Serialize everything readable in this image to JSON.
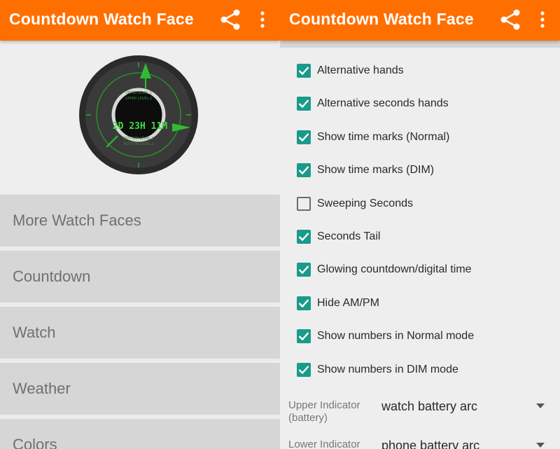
{
  "app_title": "Countdown Watch Face",
  "icons": {
    "share": "share-icon",
    "more": "more-vert-icon"
  },
  "colors": {
    "appbar": "#ff6f00",
    "accent": "#1a9a8a",
    "watch_green": "#3ddc3d"
  },
  "watch": {
    "upper_level_1": "UPPER LEVEL 1",
    "upper_level_2": "UPPER LEVEL 2",
    "countdown": "2D 23H 11M",
    "bottom_level_1": "BOTTOM LEVEL 1",
    "bottom_level_2": "BOTTOM LEVEL 2"
  },
  "menu": [
    {
      "label": "More Watch Faces"
    },
    {
      "label": "Countdown"
    },
    {
      "label": "Watch"
    },
    {
      "label": "Weather"
    },
    {
      "label": "Colors"
    }
  ],
  "settings": [
    {
      "label": "Alternative hands",
      "checked": true
    },
    {
      "label": "Alternative seconds hands",
      "checked": true
    },
    {
      "label": "Show time marks (Normal)",
      "checked": true
    },
    {
      "label": "Show time marks (DIM)",
      "checked": true
    },
    {
      "label": "Sweeping Seconds",
      "checked": false
    },
    {
      "label": "Seconds Tail",
      "checked": true
    },
    {
      "label": "Glowing countdown/digital time",
      "checked": true
    },
    {
      "label": "Hide AM/PM",
      "checked": true
    },
    {
      "label": "Show numbers in Normal mode",
      "checked": true
    },
    {
      "label": "Show numbers in DIM mode",
      "checked": true
    }
  ],
  "indicators": [
    {
      "name": "Upper Indicator (battery)",
      "value": "watch battery arc"
    },
    {
      "name": "Lower Indicator",
      "value": "phone battery arc"
    }
  ]
}
